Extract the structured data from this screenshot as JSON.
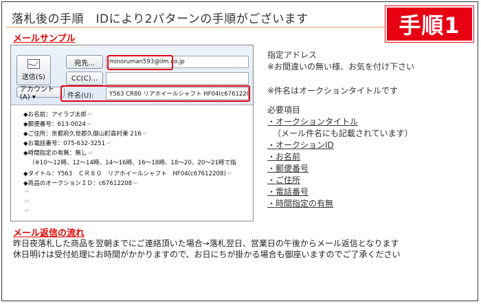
{
  "header": {
    "title": "落札後の手順　IDにより2パターンの手順がございます",
    "step_badge": "手順1"
  },
  "mail_sample": {
    "label": "メールサンプル",
    "send_button": "送信(S)",
    "to_button": "宛先...",
    "cc_button": "CC(C)...",
    "account_button": "アカウント(A) ▾",
    "subject_label": "件名(U):",
    "to_value": "minoruman593@ilm.co.jp",
    "subject_value": "Y563  CR80  リアホイールシャフト  HF04(c67612208)",
    "body_lines": [
      "◆お名前：アイラブ太郎",
      "◆郵便番号：613-0024",
      "◆ご住所：京都府久世郡久御山町森村東 216",
      "◆お電話番号：075-632-3251",
      "◆時間指定の有無：無し",
      "（※10～12時、12～14時、14～16時、16～18時、18～20、20～21時で指",
      "◆タイトル：Y563　ＣＲ８０　リアホイールシャフト　HF04(c67612208)",
      "◆商品のオークションＩＤ：c67612208"
    ]
  },
  "instructions": {
    "address_title": "指定アドレス",
    "address_note": "※お間違いの無い様、お気を付け下さい",
    "subject_note": "※件名はオークションタイトルです",
    "required_title": "必要項目",
    "items": [
      "・オークションタイトル",
      "（メール件名にも記載されています）",
      "・オークションID",
      "・お名前",
      "・郵便番号",
      "・ご住所",
      "・電話番号",
      "・時間指定の有無"
    ]
  },
  "reply_flow": {
    "label": "メール返信の流れ",
    "line1": "昨日夜落札した商品を翌朝までにご連絡頂いた場合→落札翌日、営業日の午後からメール返信となります",
    "line2": "休日明けは受付処理にお時間がかかりますので、お日にちが掛かる場合も御座いますのでご了承ください"
  },
  "colors": {
    "accent_red": "#e60012",
    "rule_orange": "#e8a060"
  }
}
